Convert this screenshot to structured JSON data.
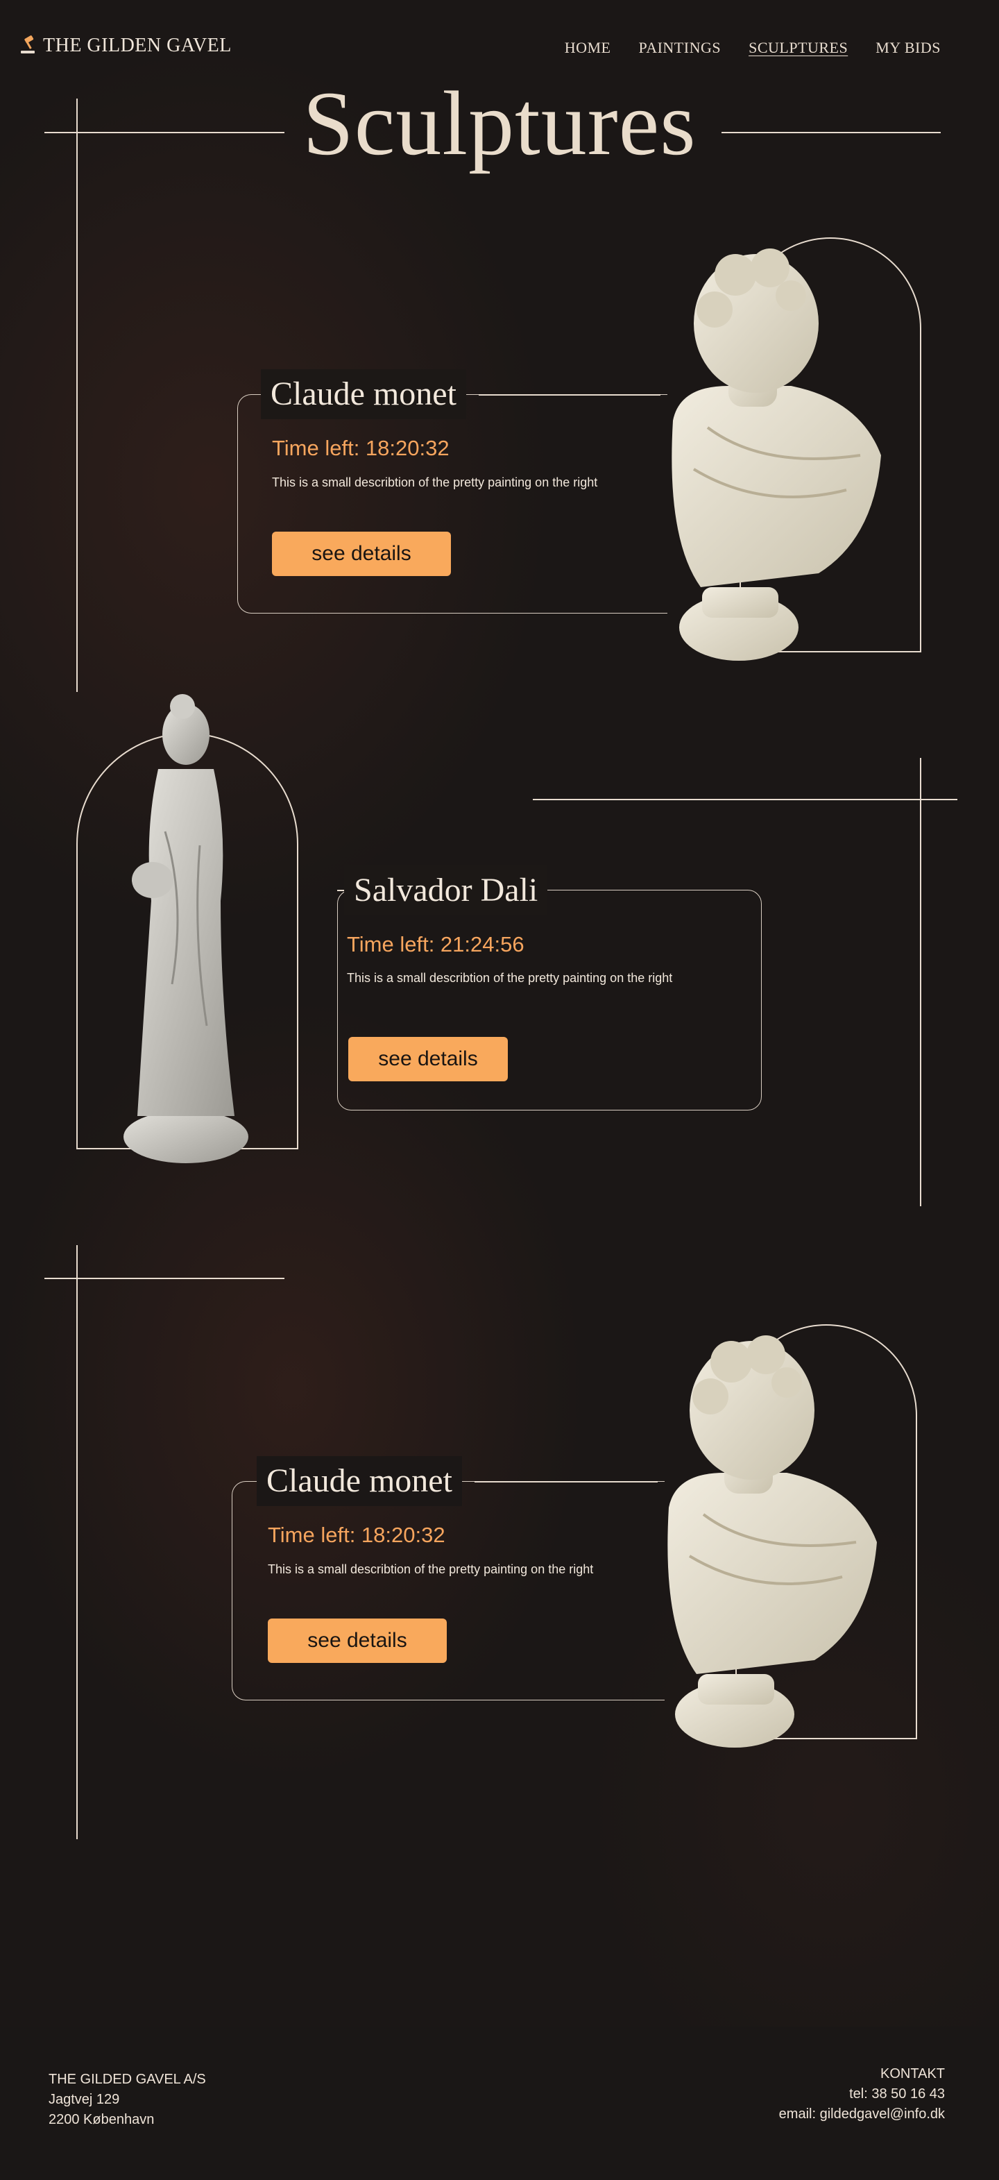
{
  "header": {
    "logo_text": "THE GILDEN GAVEL",
    "nav": [
      "HOME",
      "PAINTINGS",
      "SCULPTURES",
      "MY BIDS"
    ]
  },
  "page_title": "Sculptures",
  "cards": [
    {
      "title": "Claude monet",
      "time": "Time left: 18:20:32",
      "description": "This is a small describtion of the pretty painting on the right",
      "button": "see details",
      "image": "bust-sculpture"
    },
    {
      "title": "Salvador Dali",
      "time": "Time left: 21:24:56",
      "description": "This is a small describtion of the pretty painting on the right",
      "button": "see details",
      "image": "woman-statue"
    },
    {
      "title": "Claude monet",
      "time": "Time left: 18:20:32",
      "description": "This is a small describtion of the pretty painting on the right",
      "button": "see details",
      "image": "bust-sculpture"
    }
  ],
  "footer": {
    "company": "THE GILDED GAVEL A/S",
    "street": "Jagtvej 129",
    "city": "2200 København",
    "contact_heading": "KONTAKT",
    "phone": "tel: 38 50 16 43",
    "email": "email: gildedgavel@info.dk"
  },
  "colors": {
    "background": "#1b1716",
    "accent": "#f9a95c",
    "text": "#efe4d8"
  }
}
